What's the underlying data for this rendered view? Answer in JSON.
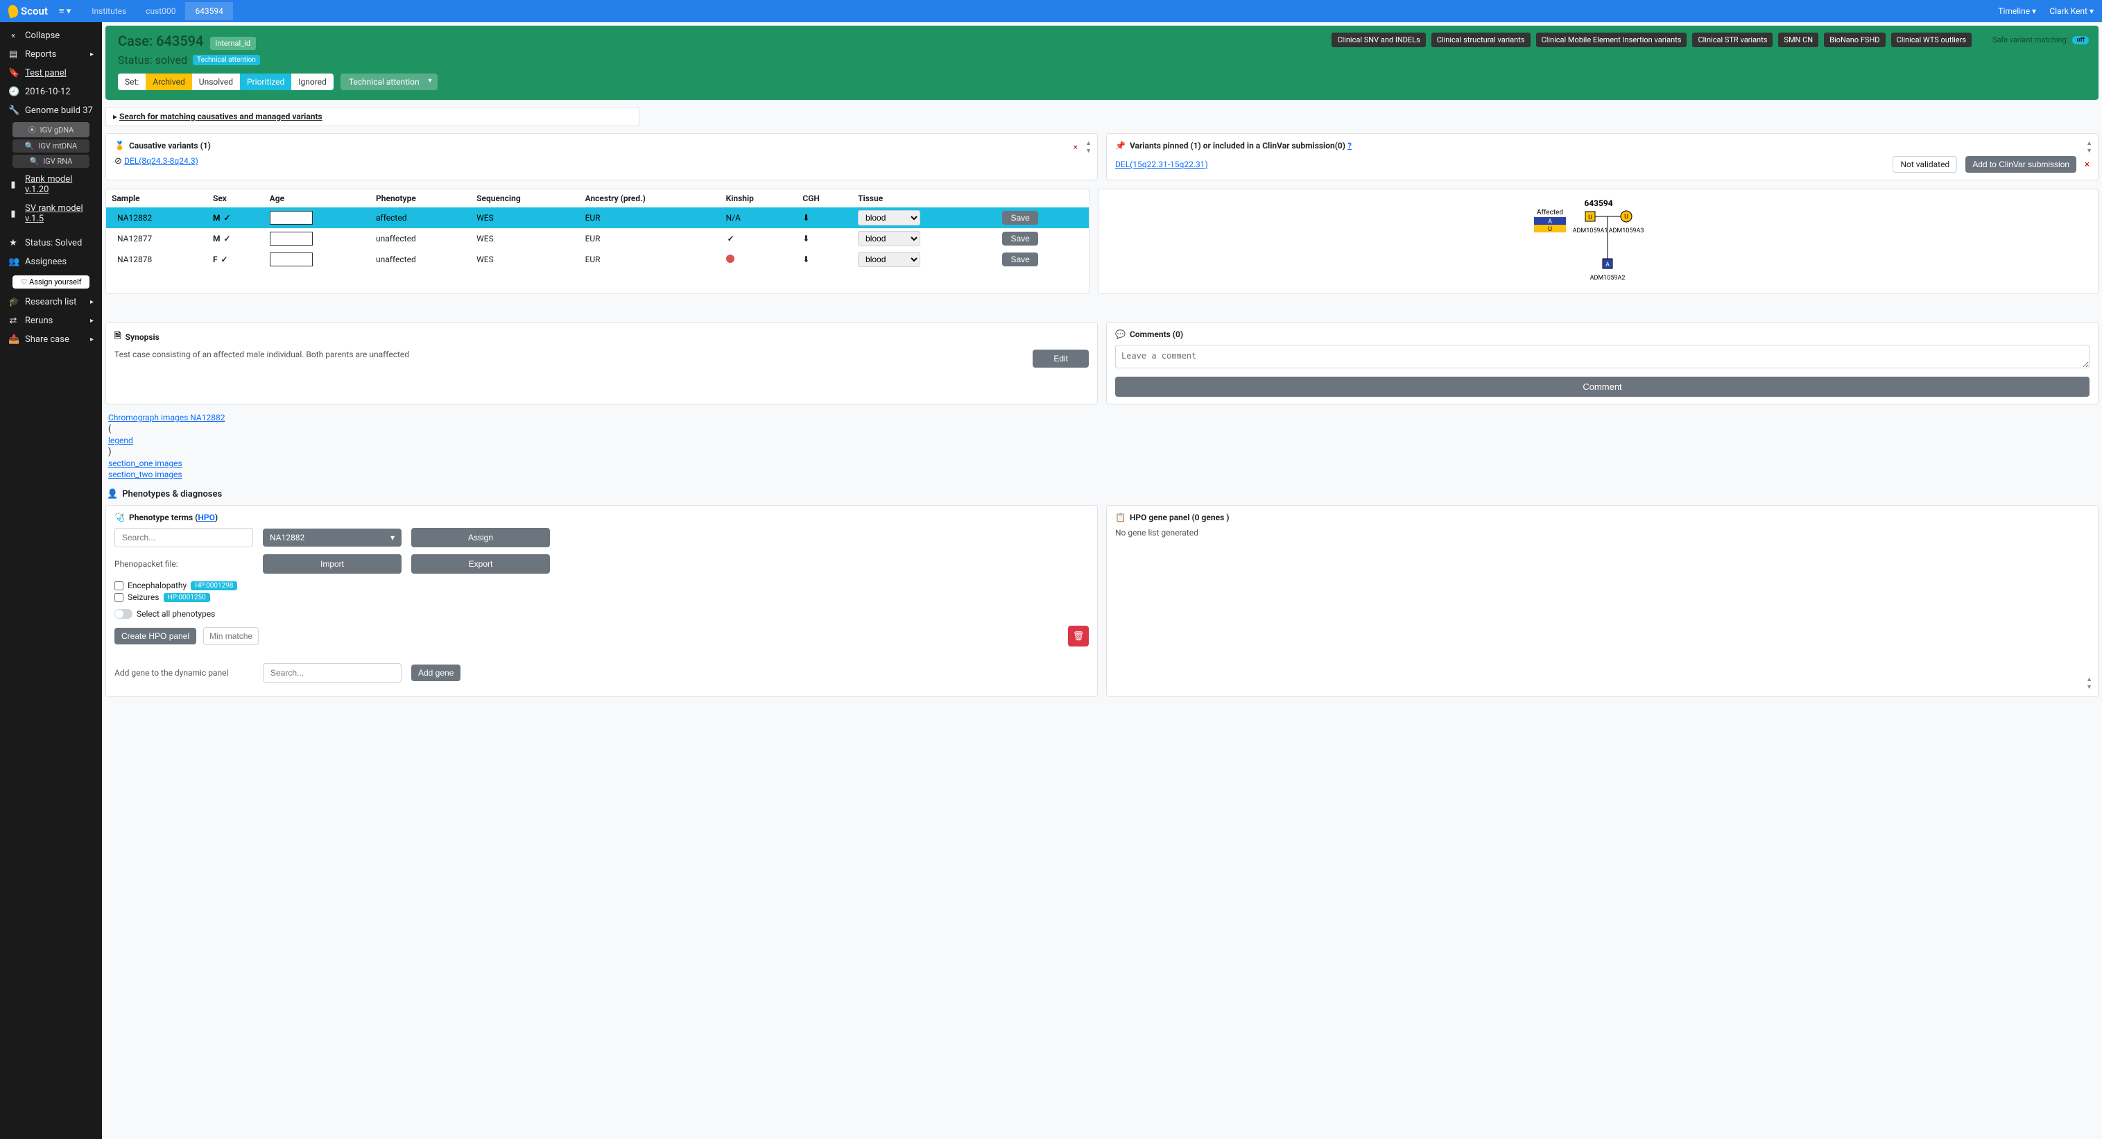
{
  "topnav": {
    "brand": "Scout",
    "crumbs": [
      "Institutes",
      "cust000",
      "643594"
    ],
    "active_crumb": 2,
    "timeline": "Timeline",
    "user": "Clark Kent"
  },
  "sidebar": {
    "collapse": "Collapse",
    "items": [
      {
        "icon": "📄",
        "label": "Reports",
        "chev": true
      },
      {
        "icon": "🔖",
        "label": "Test panel",
        "underline": true
      },
      {
        "icon": "🕘",
        "label": "2016-10-12"
      },
      {
        "icon": "🔧",
        "label": "Genome build 37"
      }
    ],
    "igv": [
      {
        "icon": "⦿",
        "label": "IGV gDNA",
        "light": true
      },
      {
        "icon": "🔍",
        "label": "IGV mtDNA"
      },
      {
        "icon": "🔍",
        "label": "IGV RNA"
      }
    ],
    "models": [
      {
        "icon": "▮",
        "label": "Rank model v.1.20",
        "underline": true
      },
      {
        "icon": "▮",
        "label": "SV rank model v.1.5",
        "underline": true
      }
    ],
    "status": [
      {
        "icon": "★",
        "label": "Status: Solved"
      },
      {
        "icon": "👥",
        "label": "Assignees"
      }
    ],
    "assign": "Assign yourself",
    "tail": [
      {
        "icon": "🎓",
        "label": "Research list",
        "chev": true
      },
      {
        "icon": "⇄",
        "label": "Reruns",
        "chev": true
      },
      {
        "icon": "📤",
        "label": "Share case",
        "chev": true
      }
    ]
  },
  "casehdr": {
    "case_label": "Case:",
    "case_id": "643594",
    "internal_id": "internal_id",
    "status_label": "Status:",
    "status_value": "solved",
    "tech_attn": "Technical attention",
    "set_label": "Set:",
    "segments": [
      "Archived",
      "Unsolved",
      "Prioritized",
      "Ignored"
    ],
    "dd_label": "Technical attention",
    "clin_nav": [
      "Clinical SNV and INDELs",
      "Clinical structural variants",
      "Clinical Mobile Element Insertion variants",
      "Clinical STR variants",
      "SMN CN",
      "BioNano FSHD",
      "Clinical WTS outliers"
    ],
    "safe_match": "Safe variant matching:",
    "safe_match_state": "off"
  },
  "searchbar": "Search for matching causatives and managed variants",
  "causative": {
    "title": "Causative variants (1)",
    "variant": "DEL(8q24.3-8q24.3)"
  },
  "pinned": {
    "title": "Variants pinned (1) or included in a ClinVar submission(0)",
    "q": "?",
    "variant": "DEL(15q22.31-15q22.31)",
    "not_validated": "Not validated",
    "add_clinvar": "Add to ClinVar submission"
  },
  "samples_cols": [
    "Sample",
    "Sex",
    "Age",
    "Phenotype",
    "Sequencing",
    "Ancestry (pred.)",
    "Kinship",
    "CGH",
    "Tissue",
    ""
  ],
  "samples": [
    {
      "id": "NA12882",
      "sex": "M",
      "pheno": "affected",
      "seq": "WES",
      "anc": "EUR",
      "kin": "N/A",
      "tissue": "blood",
      "hl": true
    },
    {
      "id": "NA12877",
      "sex": "M",
      "pheno": "unaffected",
      "seq": "WES",
      "anc": "EUR",
      "kin": "check",
      "tissue": "blood"
    },
    {
      "id": "NA12878",
      "sex": "F",
      "pheno": "unaffected",
      "seq": "WES",
      "anc": "EUR",
      "kin": "warn",
      "tissue": "blood"
    }
  ],
  "save": "Save",
  "pedigree": {
    "title": "643594",
    "affected": "Affected",
    "father": "ADM1059A1",
    "mother": "ADM1059A3",
    "child": "ADM1059A2"
  },
  "synopsis": {
    "title": "Synopsis",
    "text": "Test case consisting of an affected male individual. Both parents are unaffected",
    "edit": "Edit"
  },
  "comments": {
    "title": "Comments (0)",
    "placeholder": "Leave a comment",
    "btn": "Comment"
  },
  "img_links": {
    "l1": "Chromograph images NA12882",
    "l1b": "legend",
    "l2": "section_one images",
    "l3": "section_two images"
  },
  "diag_head": "Phenotypes & diagnoses",
  "pheno": {
    "title": "Phenotype terms (",
    "hpo": "HPO",
    "title2": ")",
    "search_ph": "Search...",
    "sample": "NA12882",
    "assign": "Assign",
    "pp_label": "Phenopacket file:",
    "import": "Import",
    "export": "Export",
    "terms": [
      {
        "name": "Encephalopathy",
        "hp": "HP:0001298"
      },
      {
        "name": "Seizures",
        "hp": "HP:0001250"
      }
    ],
    "select_all": "Select all phenotypes",
    "create": "Create HPO panel",
    "min_ph": "Min matches",
    "add_gene_label": "Add gene to the dynamic panel",
    "add_gene_btn": "Add gene"
  },
  "hpo_panel": {
    "title": "HPO gene panel (0 genes )",
    "empty": "No gene list generated"
  }
}
